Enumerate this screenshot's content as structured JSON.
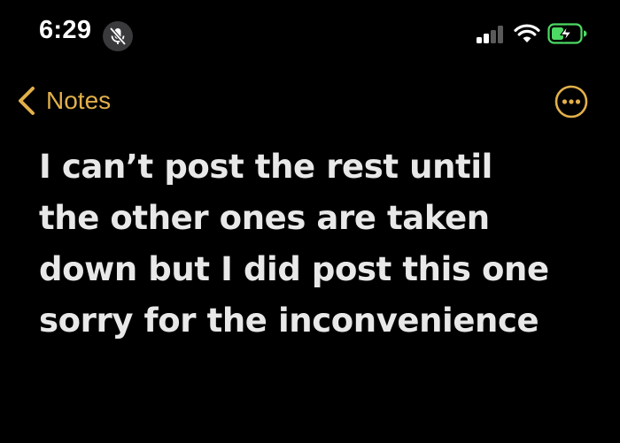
{
  "status_bar": {
    "time": "6:29",
    "mic_state": "muted",
    "icons": [
      "mic-muted-icon",
      "cellular-signal-icon",
      "wifi-icon",
      "battery-charging-icon"
    ],
    "signal_bars_active": 2,
    "signal_bars_total": 4
  },
  "nav": {
    "back_label": "Notes",
    "back_icon": "chevron-left-icon",
    "more_icon": "ellipsis-circle-icon",
    "accent_color": "#e2b04a"
  },
  "note": {
    "text": "I can’t post the rest until\nthe other ones are taken\ndown but I did post this one\nsorry for the inconvenience"
  },
  "colors": {
    "background": "#000000",
    "text": "#e8e8e8",
    "accent": "#e2b04a",
    "battery_charging": "#4cd964"
  }
}
